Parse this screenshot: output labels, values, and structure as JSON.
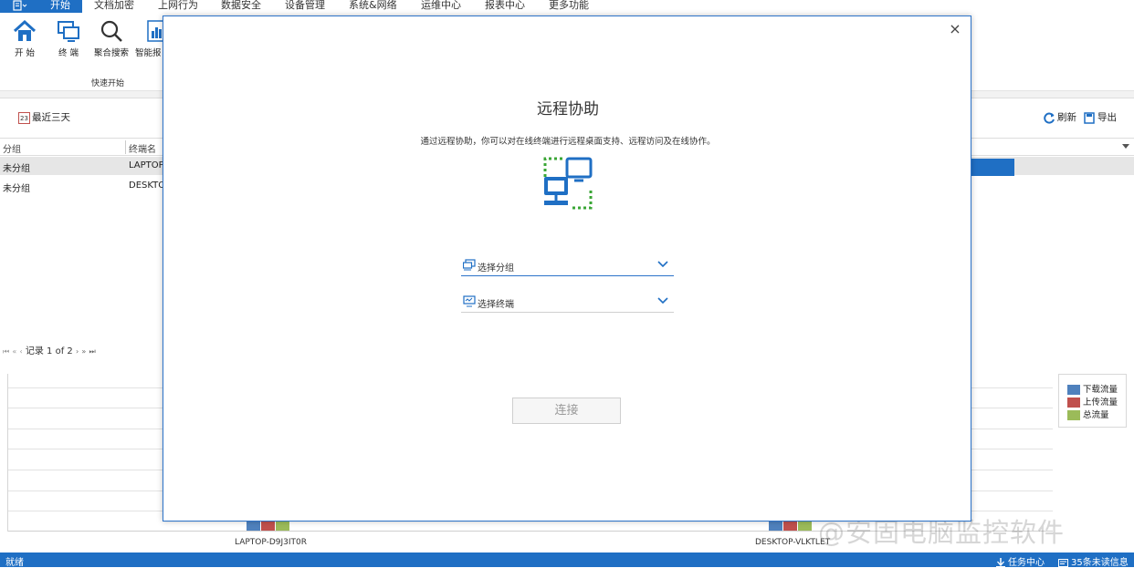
{
  "app_menu": {
    "icon": "app-menu-icon"
  },
  "tabs": [
    {
      "label": "开始"
    },
    {
      "label": "文档加密"
    },
    {
      "label": "上网行为"
    },
    {
      "label": "数据安全"
    },
    {
      "label": "设备管理"
    },
    {
      "label": "系统&网络"
    },
    {
      "label": "运维中心"
    },
    {
      "label": "报表中心"
    },
    {
      "label": "更多功能"
    }
  ],
  "ribbon": {
    "buttons": [
      {
        "label": "开 始",
        "icon": "home-icon"
      },
      {
        "label": "终 端",
        "icon": "monitor-icon"
      },
      {
        "label": "聚合搜索",
        "icon": "search-icon"
      },
      {
        "label": "智能报",
        "icon": "report-icon"
      }
    ],
    "group_label": "快速开始"
  },
  "toolbar": {
    "recent_label": "最近三天",
    "calendar_day": "23",
    "refresh_label": "刷新",
    "export_label": "导出"
  },
  "table": {
    "columns": [
      "分组",
      "终端名"
    ],
    "rows": [
      {
        "group": "未分组",
        "terminal": "LAPTOP"
      },
      {
        "group": "未分组",
        "terminal": "DESKTO"
      }
    ]
  },
  "pager": {
    "text": "记录 1 of 2"
  },
  "chart_data": {
    "type": "bar",
    "categories": [
      "LAPTOP-D9J3IT0R",
      "DESKTOP-VLKTLET"
    ],
    "series": [
      {
        "name": "下载流量",
        "color": "#4f81bd"
      },
      {
        "name": "上传流量",
        "color": "#c0504d"
      },
      {
        "name": "总流量",
        "color": "#9bbb59"
      }
    ],
    "legend_position": "right"
  },
  "status": {
    "ready": "就绪",
    "task_center": "任务中心",
    "unread": "35条未读信息"
  },
  "watermark": "@安固电脑监控软件",
  "dialog": {
    "title": "远程协助",
    "description": "通过远程协助，你可以对在线终端进行远程桌面支持、远程访问及在线协作。",
    "select_group_placeholder": "选择分组",
    "select_terminal_placeholder": "选择终端",
    "connect_label": "连接",
    "close_symbol": "×"
  },
  "colors": {
    "accent": "#1f6fc4",
    "green": "#3aa635"
  }
}
